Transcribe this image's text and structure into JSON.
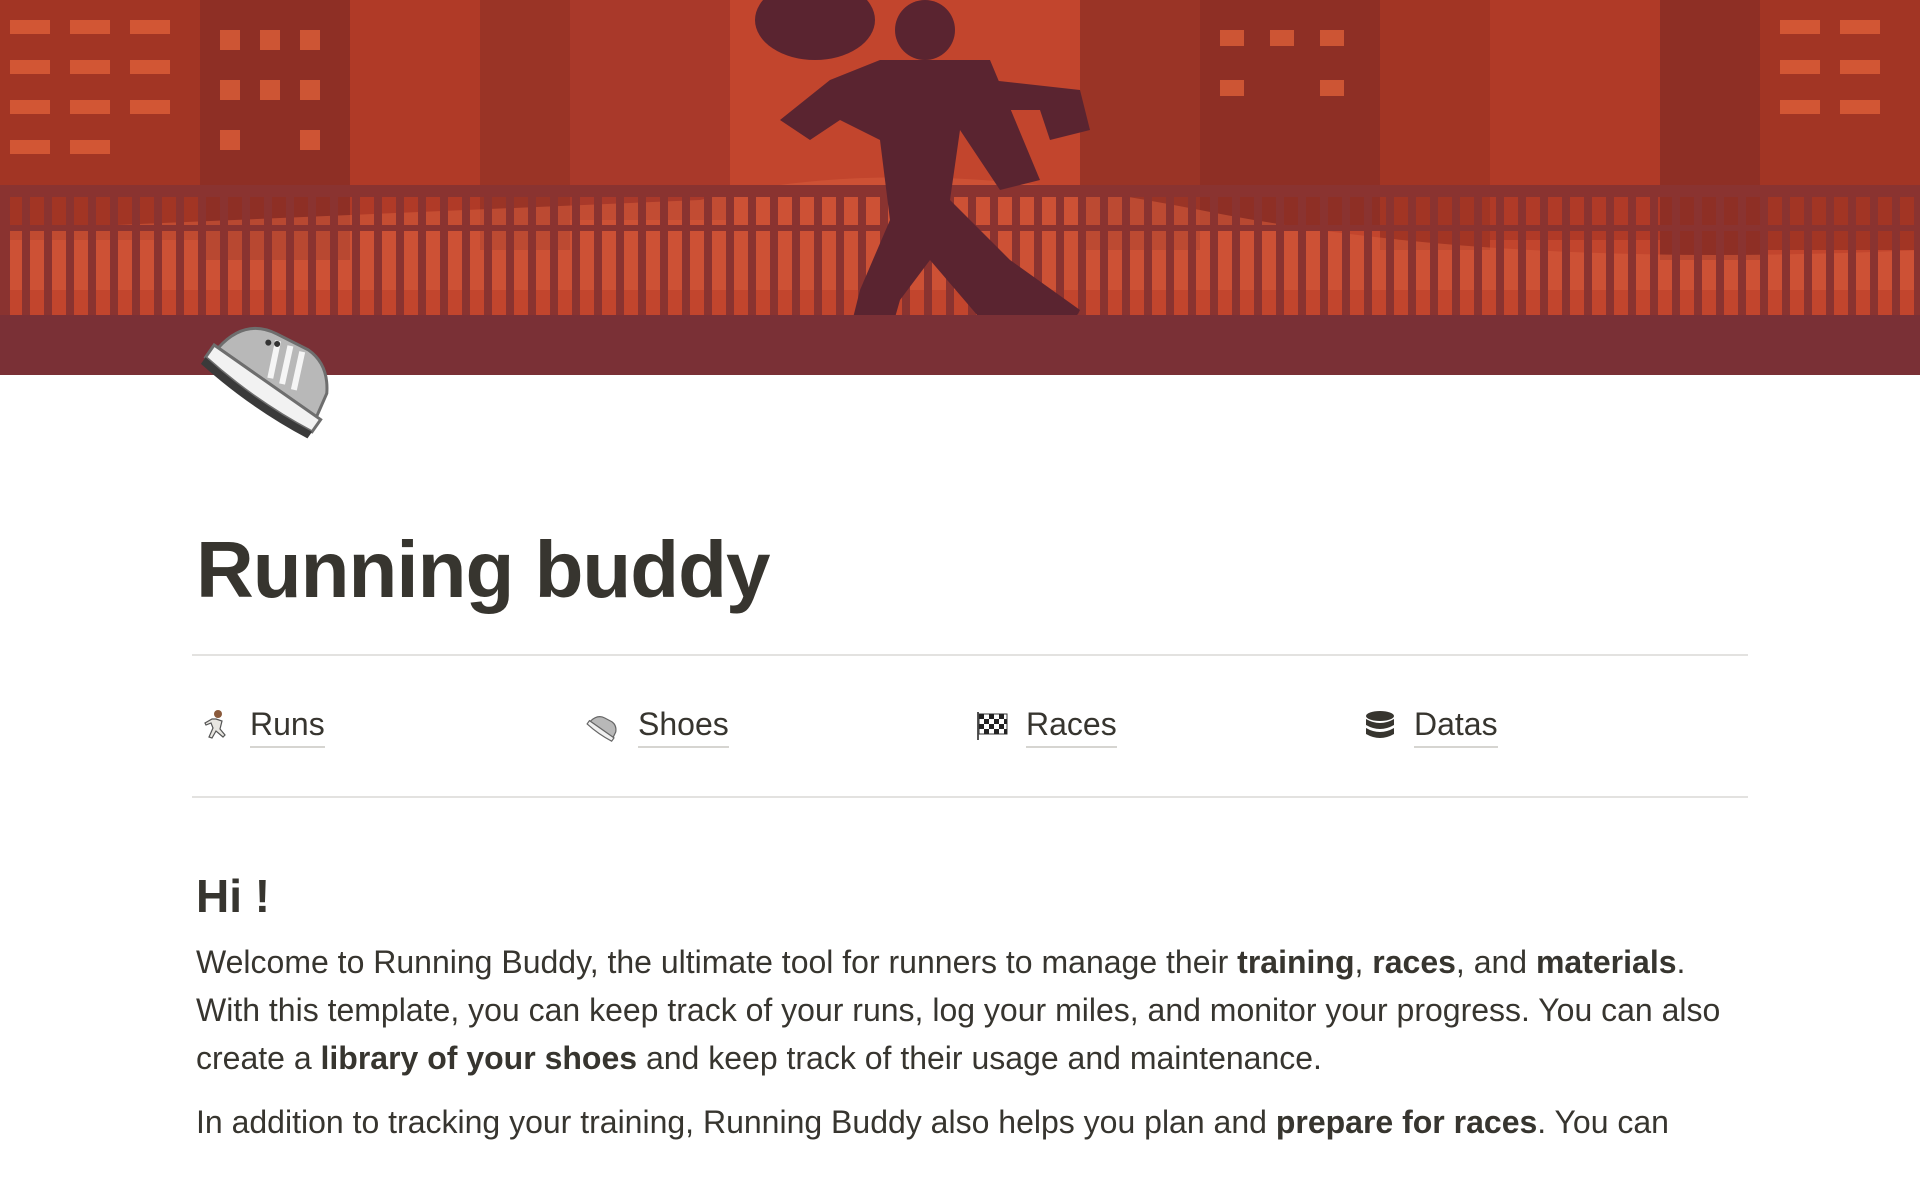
{
  "cover": {
    "description_colors": {
      "sky": "#c2452d",
      "building": "#a23524",
      "building_dark": "#8e2f25",
      "window": "#e3623a",
      "bridge": "#7a3036",
      "runner": "#5a2430"
    }
  },
  "page": {
    "icon": "sneaker-icon",
    "title": "Running buddy"
  },
  "nav": [
    {
      "icon": "runner-icon",
      "label": "Runs"
    },
    {
      "icon": "sneaker-icon",
      "label": "Shoes"
    },
    {
      "icon": "checkered-flag-icon",
      "label": "Races"
    },
    {
      "icon": "database-icon",
      "label": "Datas"
    }
  ],
  "intro": {
    "heading": "Hi !",
    "p1": {
      "t1": "Welcome to Running Buddy, the ultimate tool for runners to manage their ",
      "b1": "training",
      "t2": ", ",
      "b2": "races",
      "t3": ", and ",
      "b3": "materials",
      "t4": ". With this template, you can keep track of your runs, log your miles, and monitor your progress. You can also create a ",
      "b4": "library of your shoes",
      "t5": " and keep track of their usage and maintenance."
    },
    "p2": {
      "t1": "In addition to tracking your training, Running Buddy also helps you plan and ",
      "b1": "prepare for races",
      "t2": ". You can"
    }
  }
}
